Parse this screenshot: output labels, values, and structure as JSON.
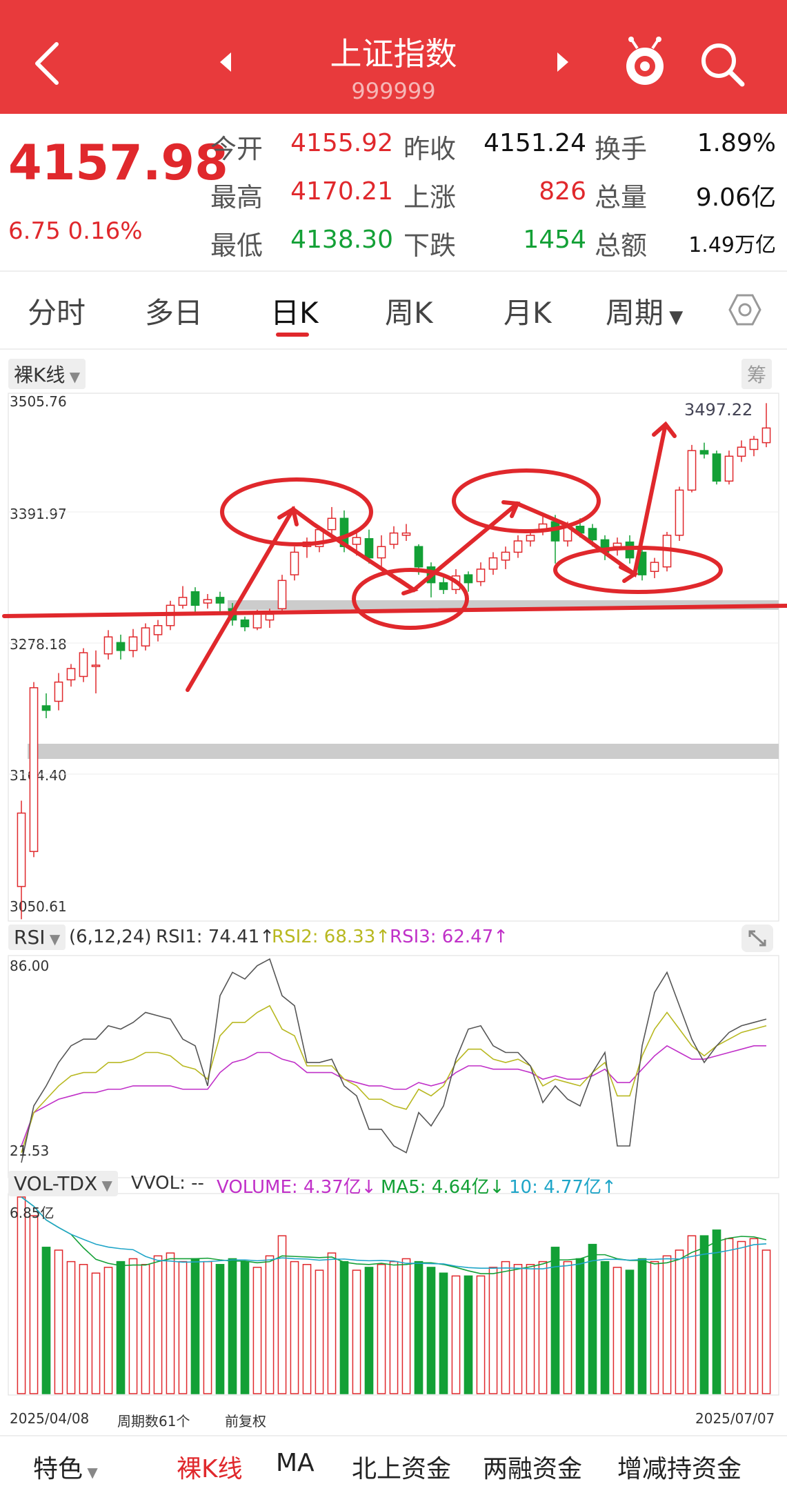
{
  "header": {
    "title": "上证指数",
    "code": "999999",
    "color": "#e83a3c"
  },
  "quote": {
    "price": "4157.98",
    "change": "6.75  0.16%",
    "rows": [
      {
        "l1": "今开",
        "v1": "4155.92",
        "l2": "昨收",
        "v2": "4151.24",
        "l3": "换手",
        "v3": "1.89%"
      },
      {
        "l1": "最高",
        "v1": "4170.21",
        "l2": "上涨",
        "v2": "826",
        "l3": "总量",
        "v3": "9.06亿"
      },
      {
        "l1": "最低",
        "v1": "4138.30",
        "l2": "下跌",
        "v2": "1454",
        "l3": "总额",
        "v3": "1.49万亿"
      }
    ]
  },
  "period_tabs": [
    "分时",
    "多日",
    "日K",
    "周K",
    "月K",
    "周期"
  ],
  "active_tab": "日K",
  "kline": {
    "mode": "裸K线",
    "chip_right": "筹",
    "y_labels": [
      "3505.76",
      "3391.97",
      "3278.18",
      "3164.40",
      "3050.61"
    ],
    "high_label": "3497.22",
    "up_color": "#e0282c",
    "down_color": "#13a036"
  },
  "rsi": {
    "label": "RSI",
    "params": "(6,12,24)",
    "rsi1": "RSI1: 74.41↑",
    "rsi2": "RSI2: 68.33↑",
    "rsi3": "RSI3: 62.47↑",
    "top": "86.00",
    "bottom": "21.53",
    "colors": {
      "rsi1": "#555555",
      "rsi2": "#b8b820",
      "rsi3": "#c030c8"
    }
  },
  "volume": {
    "label": "VOL-TDX",
    "vvol": "VVOL: --",
    "volume": "VOLUME: 4.37亿↓",
    "ma5": "MA5: 4.64亿↓",
    "ma10": "10: 4.77亿↑",
    "top": "6.85亿",
    "start_date": "2025/04/08",
    "periods": "周期数61个",
    "adjust": "前复权",
    "end_date": "2025/07/07",
    "colors": {
      "volume": "#c030c8",
      "ma5": "#13a036",
      "ma10": "#1fa5c8"
    }
  },
  "bottom_tabs": [
    "特色",
    "裸K线",
    "MA",
    "北上资金",
    "两融资金",
    "增减持资金"
  ],
  "chart_data": {
    "type": "candlestick",
    "dates": [
      "2025/04/08",
      "2025/07/07"
    ],
    "ylim": [
      3050.61,
      3505.76
    ],
    "candles": [
      [
        3069,
        3134,
        3040,
        3145
      ],
      [
        3100,
        3245,
        3095,
        3250
      ],
      [
        3229,
        3225,
        3218,
        3240
      ],
      [
        3233,
        3250,
        3225,
        3258
      ],
      [
        3252,
        3262,
        3246,
        3266
      ],
      [
        3255,
        3276,
        3250,
        3280
      ],
      [
        3265,
        3265,
        3240,
        3278
      ],
      [
        3275,
        3290,
        3270,
        3296
      ],
      [
        3285,
        3278,
        3270,
        3292
      ],
      [
        3278,
        3290,
        3272,
        3297
      ],
      [
        3282,
        3298,
        3278,
        3302
      ],
      [
        3292,
        3300,
        3286,
        3305
      ],
      [
        3300,
        3318,
        3296,
        3322
      ],
      [
        3318,
        3325,
        3315,
        3335
      ],
      [
        3330,
        3318,
        3312,
        3334
      ],
      [
        3320,
        3323,
        3315,
        3328
      ],
      [
        3325,
        3320,
        3312,
        3330
      ],
      [
        3315,
        3305,
        3300,
        3320
      ],
      [
        3305,
        3299,
        3295,
        3308
      ],
      [
        3298,
        3312,
        3296,
        3314
      ],
      [
        3305,
        3310,
        3298,
        3315
      ],
      [
        3315,
        3340,
        3312,
        3345
      ],
      [
        3345,
        3365,
        3340,
        3370
      ],
      [
        3370,
        3374,
        3360,
        3378
      ],
      [
        3370,
        3385,
        3365,
        3388
      ],
      [
        3385,
        3395,
        3380,
        3405
      ],
      [
        3395,
        3370,
        3365,
        3402
      ],
      [
        3372,
        3378,
        3362,
        3385
      ],
      [
        3377,
        3360,
        3355,
        3385
      ],
      [
        3360,
        3370,
        3350,
        3380
      ],
      [
        3372,
        3382,
        3368,
        3388
      ],
      [
        3380,
        3382,
        3375,
        3390
      ],
      [
        3370,
        3352,
        3345,
        3372
      ],
      [
        3352,
        3338,
        3325,
        3356
      ],
      [
        3338,
        3332,
        3328,
        3345
      ],
      [
        3332,
        3344,
        3328,
        3350
      ],
      [
        3345,
        3338,
        3330,
        3348
      ],
      [
        3339,
        3350,
        3335,
        3356
      ],
      [
        3350,
        3360,
        3345,
        3365
      ],
      [
        3358,
        3365,
        3350,
        3370
      ],
      [
        3365,
        3375,
        3360,
        3380
      ],
      [
        3375,
        3380,
        3370,
        3385
      ],
      [
        3385,
        3390,
        3380,
        3398
      ],
      [
        3392,
        3375,
        3355,
        3398
      ],
      [
        3375,
        3388,
        3370,
        3392
      ],
      [
        3388,
        3382,
        3378,
        3395
      ],
      [
        3386,
        3376,
        3370,
        3390
      ],
      [
        3376,
        3365,
        3358,
        3380
      ],
      [
        3370,
        3373,
        3362,
        3378
      ],
      [
        3374,
        3360,
        3355,
        3380
      ],
      [
        3365,
        3345,
        3340,
        3368
      ],
      [
        3348,
        3356,
        3342,
        3360
      ],
      [
        3352,
        3380,
        3348,
        3383
      ],
      [
        3380,
        3420,
        3375,
        3423
      ],
      [
        3420,
        3455,
        3418,
        3460
      ],
      [
        3455,
        3452,
        3448,
        3462
      ],
      [
        3452,
        3428,
        3425,
        3455
      ],
      [
        3428,
        3450,
        3425,
        3455
      ],
      [
        3450,
        3458,
        3445,
        3464
      ],
      [
        3456,
        3465,
        3450,
        3468
      ],
      [
        3462,
        3475,
        3458,
        3497
      ]
    ],
    "volume_yi": [
      6.85,
      6.2,
      5.1,
      5.0,
      4.6,
      4.5,
      4.2,
      4.4,
      4.6,
      4.7,
      4.5,
      4.8,
      4.9,
      4.6,
      4.7,
      4.6,
      4.5,
      4.7,
      4.6,
      4.4,
      4.8,
      5.5,
      4.6,
      4.5,
      4.3,
      4.9,
      4.6,
      4.3,
      4.4,
      4.5,
      4.6,
      4.7,
      4.6,
      4.4,
      4.2,
      4.1,
      4.1,
      4.1,
      4.4,
      4.6,
      4.5,
      4.5,
      4.6,
      5.1,
      4.6,
      4.7,
      5.2,
      4.6,
      4.4,
      4.3,
      4.7,
      4.6,
      4.8,
      5.0,
      5.5,
      5.5,
      5.7,
      5.4,
      5.3,
      5.4,
      5.0
    ],
    "rsi1": [
      25,
      42,
      48,
      55,
      60,
      62,
      62,
      66,
      65,
      67,
      70,
      69,
      68,
      62,
      60,
      48,
      75,
      82,
      80,
      84,
      86,
      75,
      72,
      55,
      55,
      56,
      48,
      45,
      35,
      35,
      30,
      28,
      40,
      36,
      42,
      56,
      65,
      66,
      60,
      58,
      58,
      54,
      43,
      48,
      44,
      42,
      52,
      58,
      30,
      30,
      60,
      76,
      82,
      72,
      62,
      55,
      60,
      64,
      66,
      67,
      68
    ],
    "rsi2": [
      28,
      40,
      44,
      48,
      51,
      52,
      52,
      55,
      55,
      56,
      58,
      58,
      57,
      54,
      53,
      50,
      63,
      67,
      67,
      70,
      72,
      65,
      63,
      54,
      54,
      54,
      50,
      48,
      44,
      44,
      42,
      41,
      47,
      45,
      48,
      55,
      59,
      59,
      56,
      55,
      56,
      54,
      48,
      50,
      49,
      48,
      52,
      55,
      45,
      45,
      57,
      65,
      70,
      65,
      60,
      57,
      60,
      62,
      64,
      65,
      66
    ],
    "rsi3": [
      30,
      40,
      42,
      44,
      45,
      46,
      46,
      47,
      47,
      48,
      48,
      48,
      48,
      47,
      47,
      47,
      52,
      55,
      56,
      58,
      58,
      56,
      55,
      52,
      52,
      52,
      50,
      49,
      48,
      48,
      47,
      47,
      49,
      48,
      49,
      52,
      54,
      54,
      53,
      53,
      53,
      52,
      50,
      51,
      50,
      50,
      51,
      53,
      49,
      49,
      53,
      57,
      60,
      58,
      56,
      56,
      57,
      58,
      59,
      60,
      60
    ]
  }
}
